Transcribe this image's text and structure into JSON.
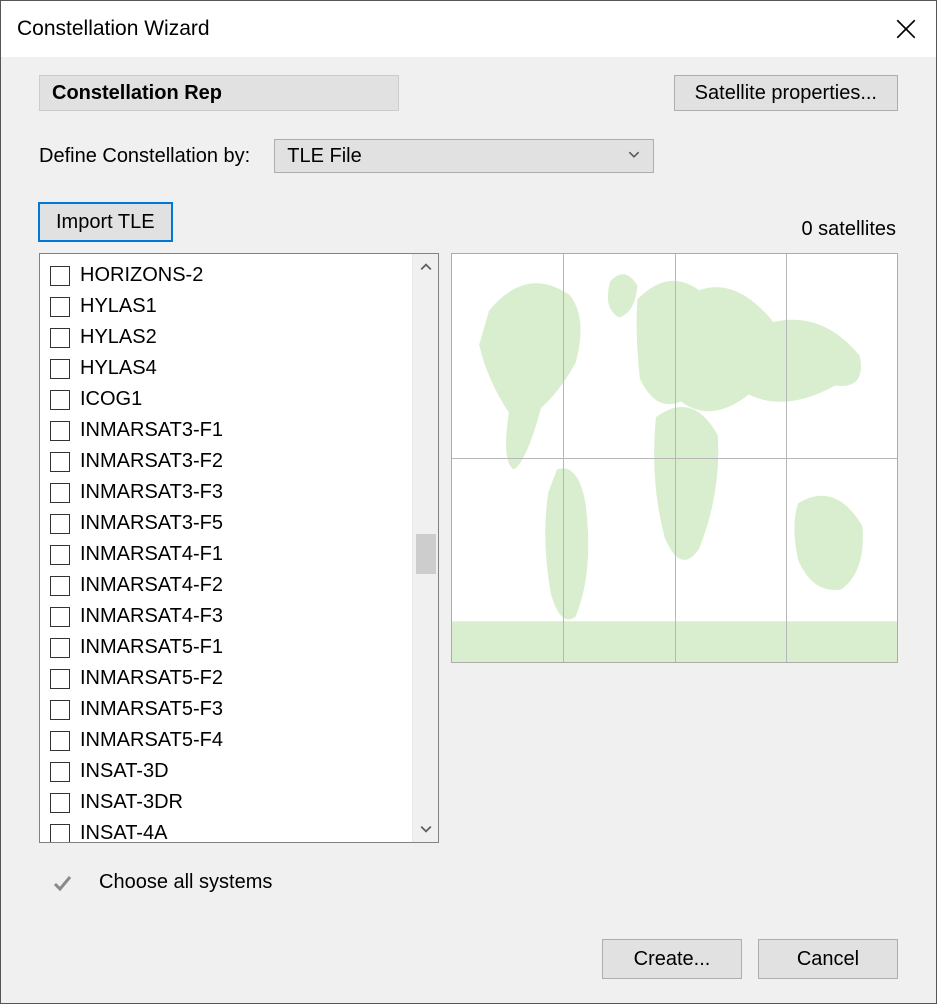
{
  "window": {
    "title": "Constellation Wizard"
  },
  "section": {
    "header": "Constellation Rep"
  },
  "buttons": {
    "satellite_properties": "Satellite properties...",
    "import_tle": "Import TLE",
    "create": "Create...",
    "cancel": "Cancel"
  },
  "define": {
    "label": "Define Constellation by:",
    "selected": "TLE File"
  },
  "status": {
    "sat_count": "0 satellites"
  },
  "choose_all": {
    "label": "Choose all systems"
  },
  "satellites": [
    "HORIZONS-2",
    "HYLAS1",
    "HYLAS2",
    "HYLAS4",
    "ICOG1",
    "INMARSAT3-F1",
    "INMARSAT3-F2",
    "INMARSAT3-F3",
    "INMARSAT3-F5",
    "INMARSAT4-F1",
    "INMARSAT4-F2",
    "INMARSAT4-F3",
    "INMARSAT5-F1",
    "INMARSAT5-F2",
    "INMARSAT5-F3",
    "INMARSAT5-F4",
    "INSAT-3D",
    "INSAT-3DR",
    "INSAT-4A"
  ]
}
